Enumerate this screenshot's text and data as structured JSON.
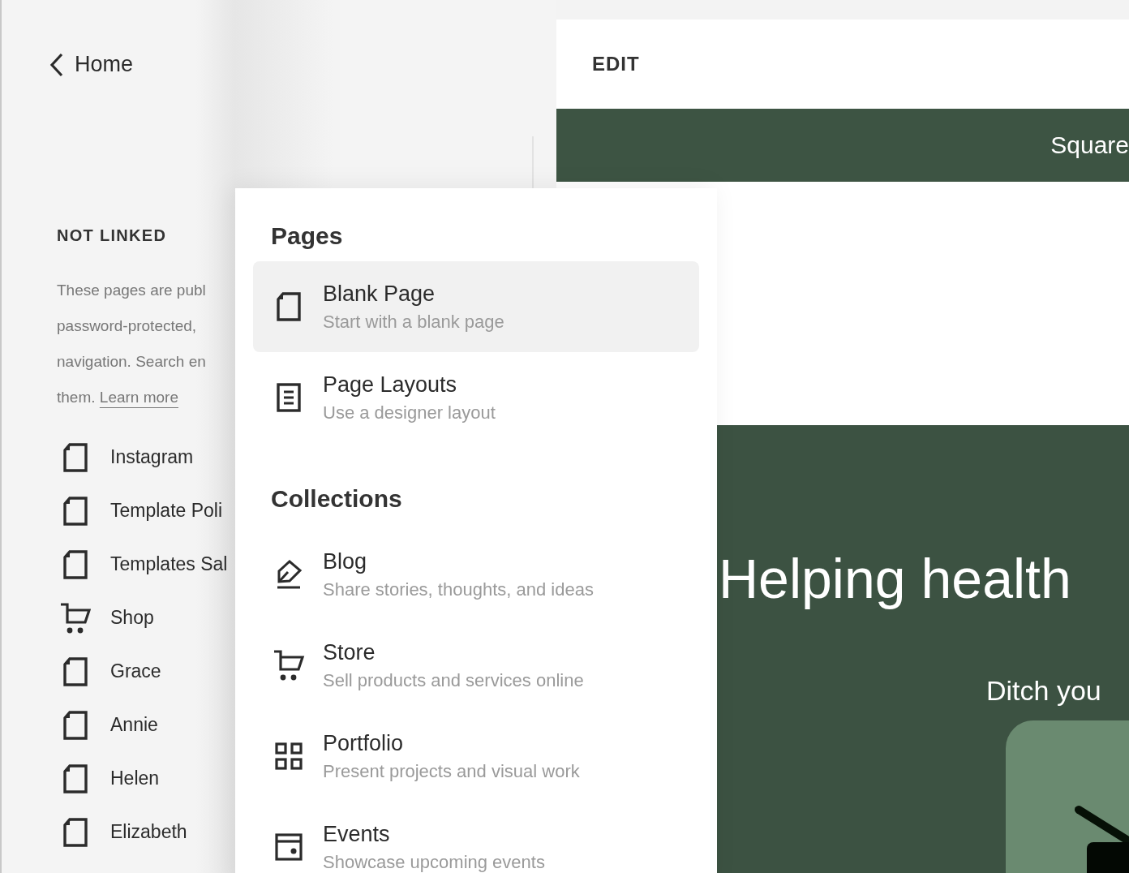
{
  "sidebar": {
    "back_link": "Home",
    "section_title": "NOT LINKED",
    "description_lines": [
      "These pages are publ",
      "password-protected,",
      "navigation. Search en",
      "them."
    ],
    "learn_more_link": "Learn more",
    "items": [
      {
        "kind": "page",
        "label": "Instagram"
      },
      {
        "kind": "page",
        "label": "Template Poli"
      },
      {
        "kind": "page",
        "label": "Templates Sal"
      },
      {
        "kind": "shop",
        "label": "Shop"
      },
      {
        "kind": "page",
        "label": "Grace"
      },
      {
        "kind": "page",
        "label": "Annie"
      },
      {
        "kind": "page",
        "label": "Helen"
      },
      {
        "kind": "page",
        "label": "Elizabeth"
      }
    ]
  },
  "add_menu": {
    "sections": [
      {
        "title": "Pages",
        "items": [
          {
            "kind": "blank",
            "title": "Blank Page",
            "subtitle": "Start with a blank page",
            "selected": true
          },
          {
            "kind": "layouts",
            "title": "Page Layouts",
            "subtitle": "Use a designer layout",
            "selected": false
          }
        ]
      },
      {
        "title": "Collections",
        "items": [
          {
            "kind": "blog",
            "title": "Blog",
            "subtitle": "Share stories, thoughts, and ideas",
            "selected": false
          },
          {
            "kind": "store",
            "title": "Store",
            "subtitle": "Sell products and services online",
            "selected": false
          },
          {
            "kind": "portfolio",
            "title": "Portfolio",
            "subtitle": "Present projects and visual work",
            "selected": false
          },
          {
            "kind": "events",
            "title": "Events",
            "subtitle": "Showcase upcoming events",
            "selected": false
          }
        ]
      }
    ]
  },
  "preview": {
    "edit_label": "EDIT",
    "banner_text": "Square",
    "hero_heading": "Helping health",
    "hero_subtext": "Ditch you"
  }
}
